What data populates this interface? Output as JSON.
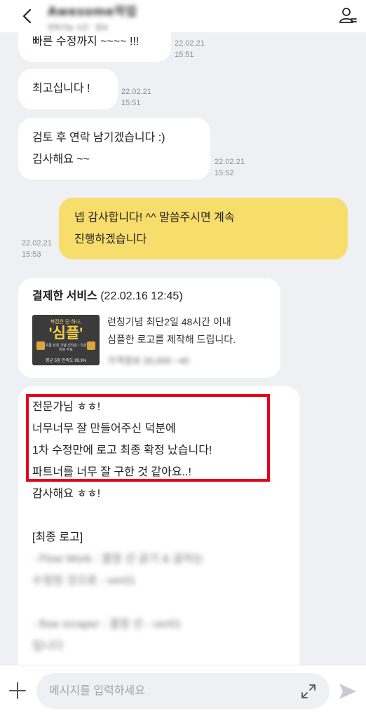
{
  "header": {
    "name": "Awesome작업",
    "subtitle": "연락가능 시간 · 정보"
  },
  "messages": [
    {
      "id": "m1",
      "lines": [
        "빠른 수정까지 ~~~~ !!!"
      ],
      "time": [
        "22.02.21",
        "15:51"
      ]
    },
    {
      "id": "m2",
      "lines": [
        "최고십니다 !"
      ],
      "time": [
        "22.02.21",
        "15:51"
      ]
    },
    {
      "id": "m3",
      "lines": [
        "검토 후 연락 남기겠습니다 :)",
        "김사해요 ~~"
      ],
      "time": [
        "22.02.21",
        "15:52"
      ]
    },
    {
      "id": "m4",
      "lines": [
        "넵 감사합니다! ^^ 말씀주시면 계속",
        "진행하겠습니다"
      ],
      "time": [
        "22.02.21",
        "15:53"
      ]
    }
  ],
  "service_card": {
    "title": "결제한 서비스",
    "date": "(22.02.16 12:45)",
    "thumb": {
      "top_text": "복잡은 단 하나,",
      "big_text": "'심플'",
      "mid_text": "프롬 런칭 기념 선착순 / 지금 바로 무료 ",
      "bottom_text": "평균 5점 만족도 99.9%"
    },
    "desc_lines": [
      "런칭기념 최단2일 48시간 이내",
      "심플한 로고를 제작해 드립니다."
    ],
    "price": "가격정보 20,000 ~40"
  },
  "long_message": {
    "lines": [
      "전문가님 ㅎㅎ!",
      "너무너무 잘 만들어주신 덕분에",
      "1차 수정만에 로고 최종 확정 났습니다!",
      "파트너를 너무 잘 구한 것 같아요..!",
      "감사해요 ㅎㅎ!",
      "",
      "[최종 로고]"
    ],
    "blurred_lines": [
      "- Flow Work : 결정 선 굵기 & 글자는",
      "수정된 것으로 - ver01",
      "",
      "- flow scraper : 결정 선 - ver01",
      "입니다"
    ]
  },
  "composer": {
    "placeholder": "메시지를 입력하세요",
    "value": ""
  },
  "icons": {
    "back": "chevron-left-icon",
    "profile": "user-menu-icon",
    "plus": "plus-icon",
    "expand": "expand-icon",
    "send": "send-icon"
  },
  "colors": {
    "chat_bg": "#eff0f3",
    "my_bubble": "#f7dd6b",
    "highlight": "#e5001a"
  }
}
